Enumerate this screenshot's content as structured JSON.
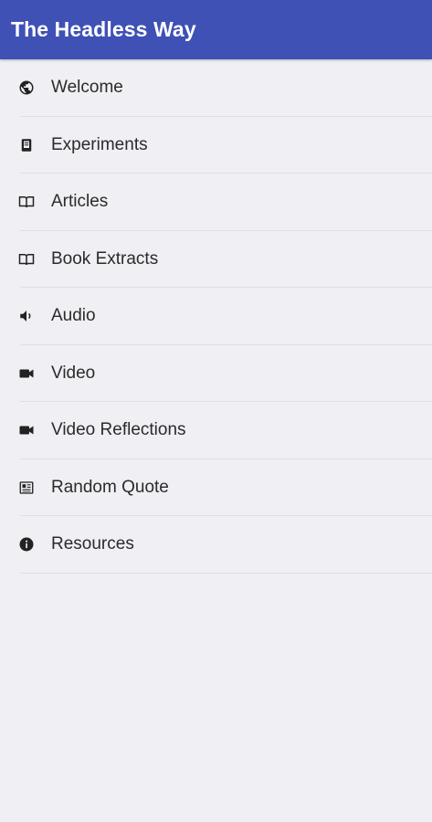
{
  "app_bar": {
    "title": "The Headless Way",
    "color": "#3f51b5"
  },
  "menu": {
    "items": [
      {
        "label": "Welcome",
        "icon": "globe-icon"
      },
      {
        "label": "Experiments",
        "icon": "document-icon"
      },
      {
        "label": "Articles",
        "icon": "book-open-icon"
      },
      {
        "label": "Book Extracts",
        "icon": "book-open-icon"
      },
      {
        "label": "Audio",
        "icon": "speaker-icon"
      },
      {
        "label": "Video",
        "icon": "video-camera-icon"
      },
      {
        "label": "Video Reflections",
        "icon": "video-camera-icon"
      },
      {
        "label": "Random Quote",
        "icon": "newspaper-icon"
      },
      {
        "label": "Resources",
        "icon": "info-icon"
      }
    ]
  }
}
